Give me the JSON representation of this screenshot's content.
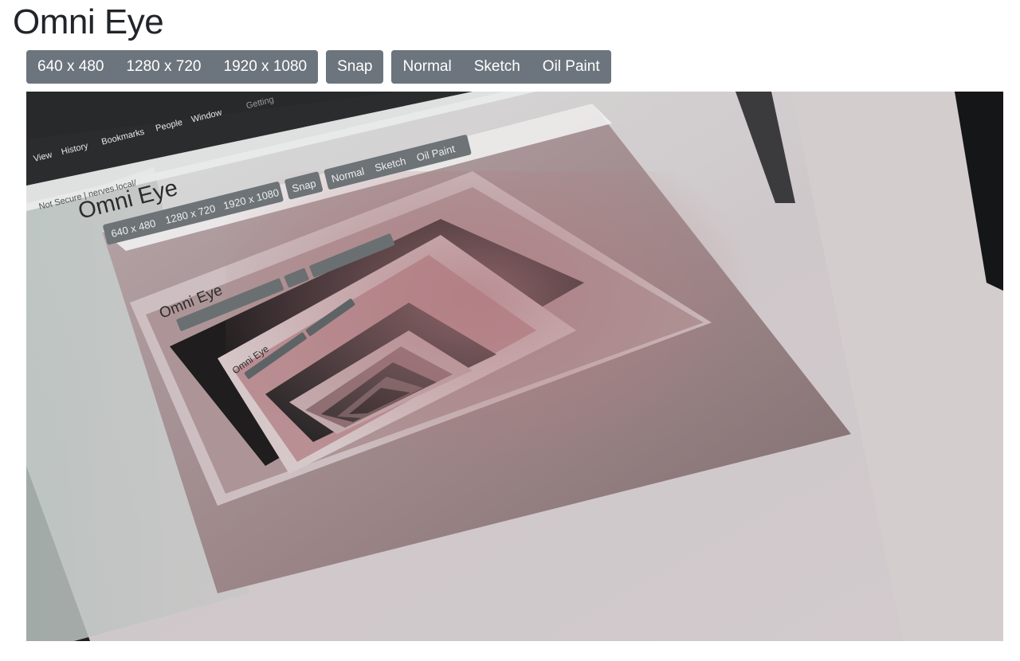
{
  "app": {
    "title": "Omni Eye"
  },
  "toolbar": {
    "resolution_buttons": [
      "640 x 480",
      "1280 x 720",
      "1920 x 1080"
    ],
    "snap_label": "Snap",
    "filter_buttons": [
      "Normal",
      "Sketch",
      "Oil Paint"
    ]
  },
  "camera_feed": {
    "feedback_title": "Omni Eye",
    "feedback_menu": [
      "View",
      "History",
      "Bookmarks",
      "People",
      "Window"
    ],
    "feedback_tab": "Getting",
    "feedback_address": "Not Secure | nerves.local/",
    "feedback_resolutions": [
      "640 x 480",
      "1280 x 720",
      "1920 x 1080"
    ],
    "feedback_snap": "Snap",
    "feedback_filters": [
      "Normal",
      "Sketch",
      "Oil Paint"
    ]
  },
  "colors": {
    "button_bg": "#6c757d",
    "button_text": "#ffffff",
    "title_text": "#212529"
  }
}
